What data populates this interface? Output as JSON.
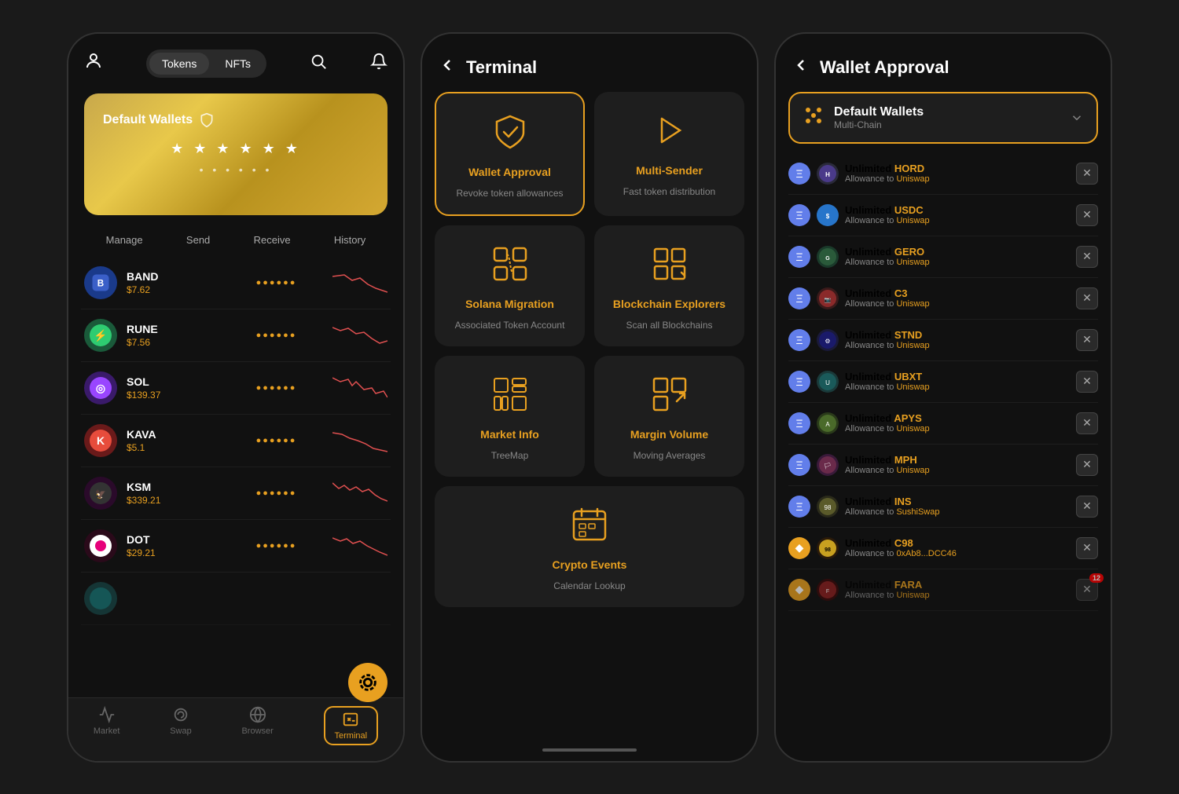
{
  "screen1": {
    "tabs": [
      "Tokens",
      "NFTs"
    ],
    "active_tab": "Tokens",
    "wallet": {
      "title": "Default Wallets",
      "stars1": "★★★★★★",
      "stars2": "●●●●●●"
    },
    "actions": [
      "Manage",
      "Send",
      "Receive",
      "History"
    ],
    "tokens": [
      {
        "name": "BAND",
        "price": "$7.62",
        "color": "#3a5fc8",
        "text": "B",
        "bg": "#1a3a8a"
      },
      {
        "name": "RUNE",
        "price": "$7.56",
        "color": "#2ecc71",
        "text": "⚡",
        "bg": "#1a5a3a"
      },
      {
        "name": "SOL",
        "price": "$139.37",
        "color": "#9945ff",
        "text": "◎",
        "bg": "#3a1a6a"
      },
      {
        "name": "KAVA",
        "price": "$5.1",
        "color": "#e74c3c",
        "text": "K",
        "bg": "#6a1a1a"
      },
      {
        "name": "KSM",
        "price": "$339.21",
        "color": "#e91e63",
        "text": "🦅",
        "bg": "#2a0a2a"
      },
      {
        "name": "DOT",
        "price": "$29.21",
        "color": "#e6007a",
        "text": "●",
        "bg": "#2a0a1a"
      }
    ],
    "nav": {
      "items": [
        "Market",
        "Swap",
        "Browser",
        "Terminal"
      ],
      "active": "Terminal"
    }
  },
  "screen2": {
    "title": "Terminal",
    "cards": [
      {
        "title": "Wallet Approval",
        "subtitle": "Revoke token allowances",
        "highlighted": true,
        "icon": "shield-check"
      },
      {
        "title": "Multi-Sender",
        "subtitle": "Fast token distribution",
        "highlighted": false,
        "icon": "send"
      },
      {
        "title": "Solana Migration",
        "subtitle": "Associated Token Account",
        "highlighted": false,
        "icon": "migration"
      },
      {
        "title": "Blockchain Explorers",
        "subtitle": "Scan all Blockchains",
        "highlighted": false,
        "icon": "scan"
      },
      {
        "title": "Market Info",
        "subtitle": "TreeMap",
        "highlighted": false,
        "icon": "market"
      },
      {
        "title": "Margin Volume",
        "subtitle": "Moving Averages",
        "highlighted": false,
        "icon": "volume"
      }
    ],
    "last_card": {
      "title": "Crypto Events",
      "subtitle": "Calendar Lookup",
      "icon": "calendar"
    }
  },
  "screen3": {
    "title": "Wallet Approval",
    "wallet": {
      "name": "Default Wallets",
      "sub": "Multi-Chain"
    },
    "allowances": [
      {
        "amount": "Unlimited",
        "token": "HORD",
        "to": "Uniswap",
        "chain_color": "#627eea",
        "token_color": "#2a2a2a"
      },
      {
        "amount": "Unlimited",
        "token": "USDC",
        "to": "Uniswap",
        "chain_color": "#627eea",
        "token_color": "#2775ca"
      },
      {
        "amount": "Unlimited",
        "token": "GERO",
        "to": "Uniswap",
        "chain_color": "#627eea",
        "token_color": "#1a3a2a"
      },
      {
        "amount": "Unlimited",
        "token": "C3",
        "to": "Uniswap",
        "chain_color": "#627eea",
        "token_color": "#3a1a1a"
      },
      {
        "amount": "Unlimited",
        "token": "STND",
        "to": "Uniswap",
        "chain_color": "#627eea",
        "token_color": "#1a1a3a"
      },
      {
        "amount": "Unlimited",
        "token": "UBXT",
        "to": "Uniswap",
        "chain_color": "#627eea",
        "token_color": "#1a3a3a"
      },
      {
        "amount": "Unlimited",
        "token": "APYS",
        "to": "Uniswap",
        "chain_color": "#627eea",
        "token_color": "#2a3a1a"
      },
      {
        "amount": "Unlimited",
        "token": "MPH",
        "to": "Uniswap",
        "chain_color": "#627eea",
        "token_color": "#3a1a3a"
      },
      {
        "amount": "Unlimited",
        "token": "INS",
        "to": "SushiSwap",
        "chain_color": "#627eea",
        "token_color": "#2a2a1a"
      },
      {
        "amount": "Unlimited",
        "token": "C98",
        "to": "0xAb8...DCC46",
        "chain_color": "#e8a020",
        "token_color": "#2a1a0a"
      },
      {
        "amount": "Unlimited",
        "token": "FARA",
        "to": "Uniswap",
        "chain_color": "#627eea",
        "token_color": "#3a0a0a"
      }
    ],
    "badge": "12"
  }
}
